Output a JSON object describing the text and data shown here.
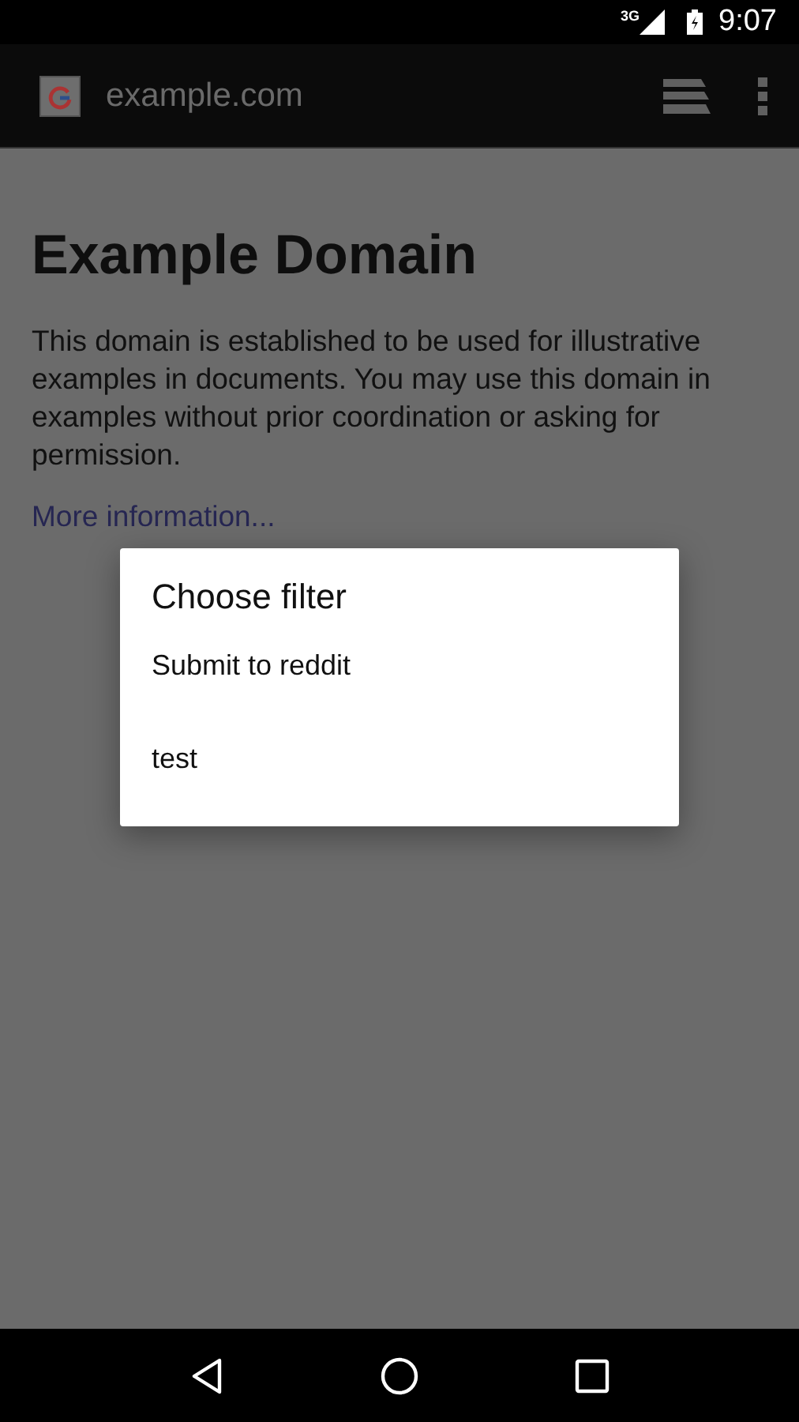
{
  "status_bar": {
    "network": "3G",
    "time": "9:07"
  },
  "toolbar": {
    "url": "example.com"
  },
  "page": {
    "heading": "Example Domain",
    "paragraph": "This domain is established to be used for illustrative examples in documents. You may use this domain in examples without prior coordination or asking for permission.",
    "link": "More information..."
  },
  "dialog": {
    "title": "Choose filter",
    "items": [
      "Submit to reddit",
      "test"
    ]
  }
}
